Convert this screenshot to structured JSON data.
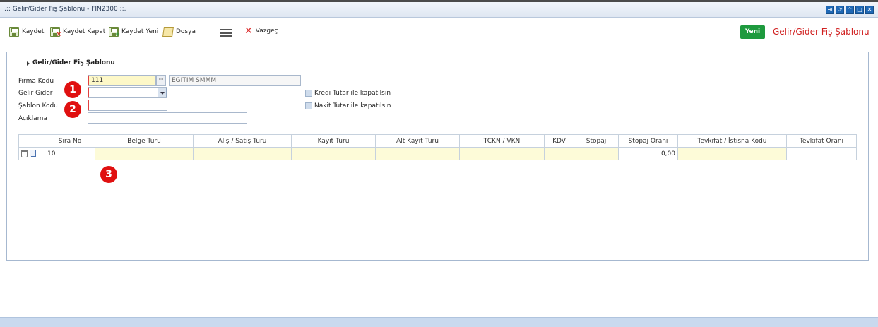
{
  "window": {
    "title": ".:: Gelir/Gider Fiş Şablonu - FIN2300 ::.",
    "controls": [
      "pin-icon",
      "refresh-icon",
      "minimize-icon",
      "maximize-icon",
      "close-icon"
    ]
  },
  "toolbar": {
    "save": "Kaydet",
    "save_close": "Kaydet Kapat",
    "save_new": "Kaydet Yeni",
    "file": "Dosya",
    "cancel": "Vazgeç",
    "new_badge": "Yeni",
    "page_heading": "Gelir/Gider Fiş Şablonu"
  },
  "colors": {
    "accent": "#1f68b5",
    "heading_red": "#d02020",
    "new_green": "#1e9a3e",
    "required_border": "#e04040"
  },
  "form": {
    "legend": "Gelir/Gider Fiş Şablonu",
    "firma_kodu_label": "Firma Kodu",
    "firma_kodu_value": "111",
    "firma_adi_value": "EĞİTİM SMMM",
    "gelir_gider_label": "Gelir Gider",
    "gelir_gider_value": "",
    "sablon_kodu_label": "Şablon Kodu",
    "sablon_kodu_value": "",
    "aciklama_label": "Açıklama",
    "aciklama_value": "",
    "kredi_check": "Kredi Tutar ile kapatılsın",
    "nakit_check": "Nakit Tutar ile kapatılsın"
  },
  "badges": [
    "1",
    "2",
    "3"
  ],
  "grid": {
    "headers": [
      "",
      "Sıra No",
      "Belge Türü",
      "Alış / Satış Türü",
      "Kayıt Türü",
      "Alt Kayıt Türü",
      "TCKN / VKN",
      "KDV",
      "Stopaj",
      "Stopaj Oranı",
      "Tevkifat / İstisna Kodu",
      "Tevkifat Oranı"
    ],
    "rows": [
      {
        "sira_no": "10",
        "belge_turu": "",
        "alis_satis_turu": "",
        "kayit_turu": "",
        "alt_kayit_turu": "",
        "tckn_vkn": "",
        "kdv": "",
        "stopaj": "",
        "stopaj_orani": "0,00",
        "tevkifat_kodu": "",
        "tevkifat_orani": ""
      }
    ]
  }
}
